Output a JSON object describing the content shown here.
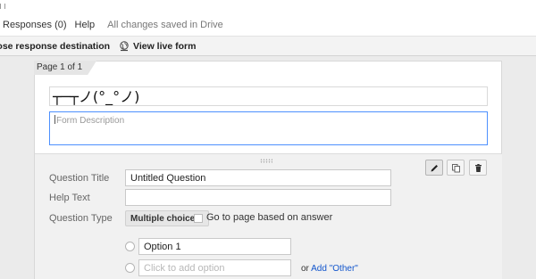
{
  "menu": {
    "items": [
      "Responses (0)",
      "Help"
    ],
    "save_status": "All changes saved in Drive"
  },
  "toolbar": {
    "choose_destination": "oose response destination",
    "view_live_form": "View live form",
    "icons": [
      "globe-icon"
    ]
  },
  "form": {
    "page_label": "Page 1 of 1",
    "title": "┬─┬ノ(°_°ノ)",
    "description_placeholder": "Form Description"
  },
  "question": {
    "title_label": "Question Title",
    "title_value": "Untitled Question",
    "help_label": "Help Text",
    "help_value": "",
    "type_label": "Question Type",
    "type_value": "Multiple choice",
    "go_to_page_label": "Go to page based on answer",
    "go_to_page_checked": false,
    "options": [
      {
        "value": "Option 1",
        "placeholder": ""
      },
      {
        "value": "",
        "placeholder": "Click to add option"
      }
    ],
    "or_text": "or",
    "add_other_link": "Add \"Other\"",
    "actions": [
      "pencil-icon",
      "duplicate-icon",
      "trash-icon"
    ]
  },
  "colors": {
    "focus_border": "#4d90fe",
    "link": "#1155cc",
    "background": "#ebebeb"
  }
}
